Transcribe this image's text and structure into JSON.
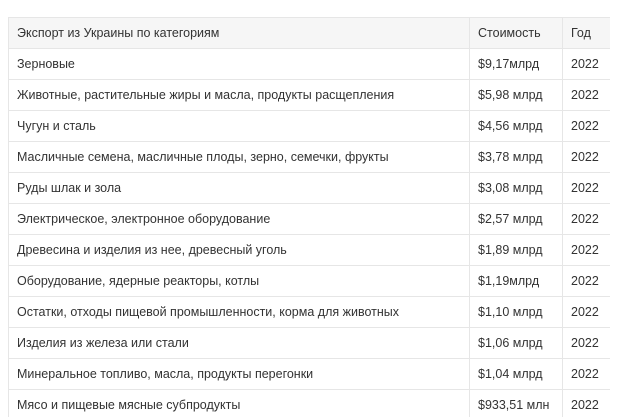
{
  "table": {
    "headers": [
      "Экспорт из Украины по категориям",
      "Стоимость",
      "Год"
    ],
    "rows": [
      {
        "category": "Зерновые",
        "value": "$9,17млрд",
        "year": "2022"
      },
      {
        "category": "Животные, растительные жиры и масла, продукты расщепления",
        "value": "$5,98 млрд",
        "year": "2022"
      },
      {
        "category": "Чугун и сталь",
        "value": "$4,56 млрд",
        "year": "2022"
      },
      {
        "category": "Масличные семена, масличные плоды, зерно, семечки, фрукты",
        "value": "$3,78 млрд",
        "year": "2022"
      },
      {
        "category": "Руды шлак и зола",
        "value": "$3,08 млрд",
        "year": "2022"
      },
      {
        "category": "Электрическое, электронное оборудование",
        "value": "$2,57 млрд",
        "year": "2022"
      },
      {
        "category": "Древесина и изделия из нее, древесный уголь",
        "value": "$1,89 млрд",
        "year": "2022"
      },
      {
        "category": "Оборудование, ядерные реакторы, котлы",
        "value": "$1,19млрд",
        "year": "2022"
      },
      {
        "category": "Остатки, отходы пищевой промышленности, корма для животных",
        "value": "$1,10 млрд",
        "year": "2022"
      },
      {
        "category": "Изделия из железа или стали",
        "value": "$1,06 млрд",
        "year": "2022"
      },
      {
        "category": "Минеральное топливо, масла, продукты перегонки",
        "value": "$1,04 млрд",
        "year": "2022"
      },
      {
        "category": "Мясо и пищевые мясные субпродукты",
        "value": "$933,51 млн",
        "year": "2022"
      }
    ]
  }
}
